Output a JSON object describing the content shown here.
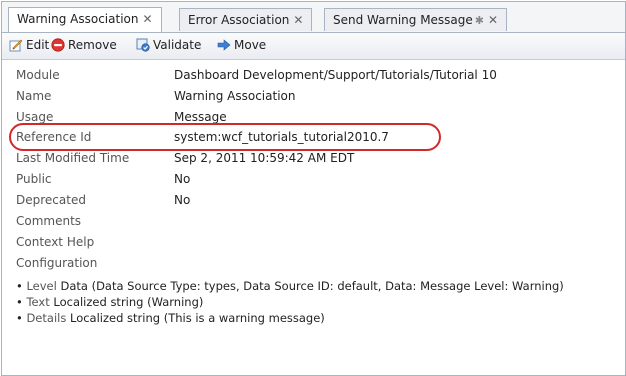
{
  "tabs": [
    {
      "label": "Warning Association",
      "active": true,
      "pinned": false
    },
    {
      "label": "Error Association",
      "active": false,
      "pinned": false
    },
    {
      "label": "Send Warning Message",
      "active": false,
      "pinned": true
    }
  ],
  "toolbar": {
    "edit_label": "Edit",
    "remove_label": "Remove",
    "validate_label": "Validate",
    "move_label": "Move"
  },
  "properties": [
    {
      "label": "Module",
      "value": "Dashboard Development/Support/Tutorials/Tutorial 10"
    },
    {
      "label": "Name",
      "value": "Warning Association"
    },
    {
      "label": "Usage",
      "value": "Message"
    },
    {
      "label": "Reference Id",
      "value": "system:wcf_tutorials_tutorial2010.7"
    },
    {
      "label": "Last Modified Time",
      "value": "Sep 2, 2011 10:59:42 AM EDT"
    },
    {
      "label": "Public",
      "value": "No"
    },
    {
      "label": "Deprecated",
      "value": "No"
    },
    {
      "label": "Comments",
      "value": ""
    },
    {
      "label": "Context Help",
      "value": ""
    },
    {
      "label": "Configuration",
      "value": ""
    }
  ],
  "configuration": [
    {
      "key": "Level",
      "value": "Data (Data Source Type: types, Data Source ID: default, Data: Message Level: Warning)"
    },
    {
      "key": "Text",
      "value": "Localized string (Warning)"
    },
    {
      "key": "Details",
      "value": "Localized string (This is a warning message)"
    }
  ],
  "colors": {
    "highlight_ellipse": "#d3282b",
    "border": "#a9b4c2"
  }
}
